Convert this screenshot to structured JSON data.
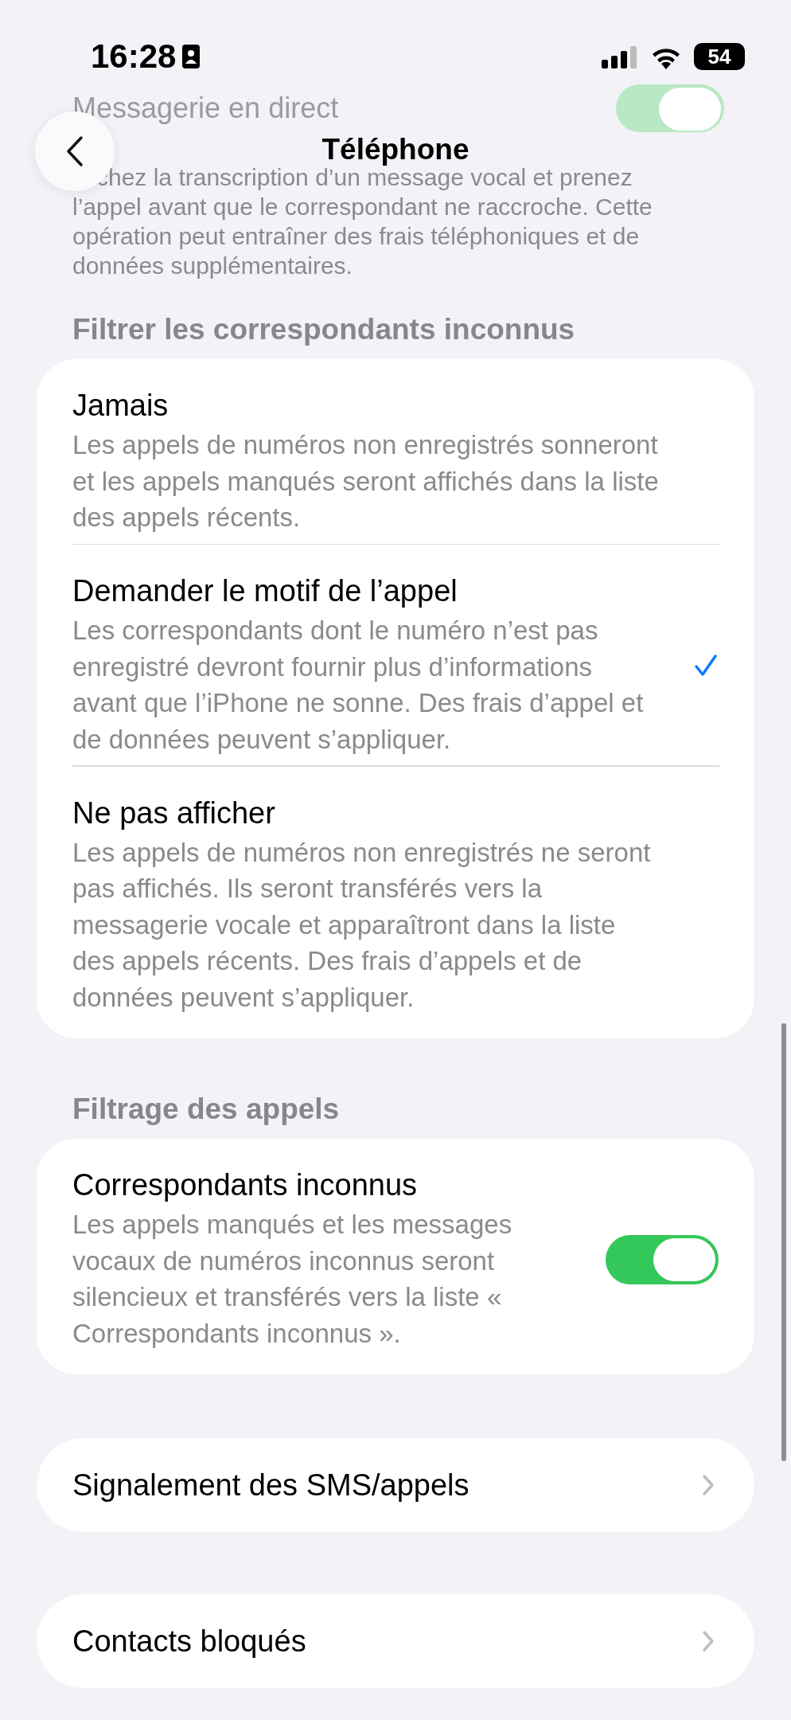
{
  "status_bar": {
    "time": "16:28",
    "battery": "54"
  },
  "nav": {
    "title": "Téléphone"
  },
  "live_voicemail": {
    "label": "Messagerie en direct",
    "on": true,
    "footer": "chez la transcription d’un message vocal et prenez l’appel avant que le correspondant ne raccroche. Cette opération peut entraîner des frais téléphoniques et de données supplémentaires."
  },
  "unknown_filter": {
    "header": "Filtrer les correspondants inconnus",
    "options": [
      {
        "title": "Jamais",
        "description": "Les appels de numéros non enregistrés sonneront et les appels manqués seront affichés dans la liste des appels récents.",
        "selected": false
      },
      {
        "title": "Demander le motif de l’appel",
        "description": "Les correspondants dont le numéro n’est pas enregistré devront fournir plus d’informations avant que l’iPhone ne sonne. Des frais d’appel et de données peuvent s’appliquer.",
        "selected": true
      },
      {
        "title": "Ne pas afficher",
        "description": "Les appels de numéros non enregistrés ne seront pas affichés. Ils seront transférés vers la messagerie vocale et apparaîtront dans la liste des appels récents. Des frais d’appels et de données peuvent s’appliquer.",
        "selected": false
      }
    ]
  },
  "call_screening": {
    "header": "Filtrage des appels",
    "title": "Correspondants inconnus",
    "description": "Les appels manqués et les messages vocaux de numéros inconnus seront silencieux et transférés vers la liste « Correspondants inconnus ».",
    "on": true
  },
  "links": [
    {
      "label": "Signalement des SMS/appels"
    },
    {
      "label": "Contacts bloqués"
    }
  ]
}
